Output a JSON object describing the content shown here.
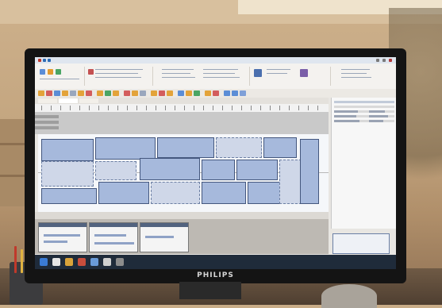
{
  "monitor": {
    "brand_logo": "PHILIPS"
  },
  "colors": {
    "room": "#c3a57f",
    "bezel": "#141414",
    "pattern_piece_fill": "#a6b9dc",
    "pattern_piece_stroke": "#44577e",
    "ribbon": "#f4f2ef",
    "taskbar": "#1f2b3a"
  },
  "icons": [
    "pen-holder-icon",
    "coffee-mug-icon",
    "monitor-stand-icon"
  ]
}
